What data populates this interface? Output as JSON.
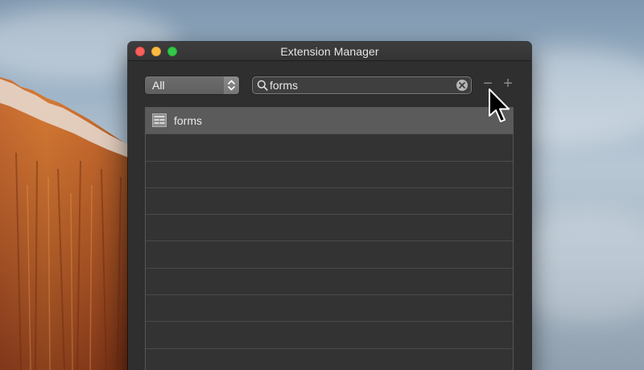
{
  "window": {
    "title": "Extension Manager"
  },
  "toolbar": {
    "filter": {
      "selected": "All",
      "icon": "chevron-updown-icon"
    },
    "search": {
      "value": "forms",
      "icon": "search-icon",
      "clear_icon": "clear-icon"
    },
    "remove_label": "−",
    "add_label": "+"
  },
  "list": {
    "rows": [
      {
        "label": "forms",
        "icon": "form-icon",
        "selected": true
      },
      {
        "label": ""
      },
      {
        "label": ""
      },
      {
        "label": ""
      },
      {
        "label": ""
      },
      {
        "label": ""
      },
      {
        "label": ""
      },
      {
        "label": ""
      },
      {
        "label": ""
      },
      {
        "label": ""
      }
    ]
  },
  "colors": {
    "close": "#fc605c",
    "minimize": "#fdbc40",
    "maximize": "#34c84a",
    "window_bg": "#2f2f30",
    "selected_row": "#5b5b5c"
  }
}
